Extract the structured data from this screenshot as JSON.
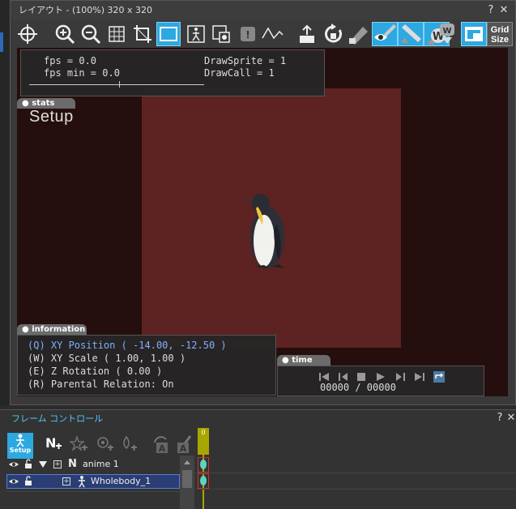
{
  "layout_window": {
    "title": "レイアウト - (100%)  320 x 320",
    "help_label": "?",
    "close_label": "✕"
  },
  "toolbar": {
    "icons": [
      "crosshair-icon",
      "zoom-in-icon",
      "zoom-out-icon",
      "grid-icon",
      "crop-icon",
      "frame-icon",
      "figure-icon",
      "layer-icon",
      "lock-icon",
      "curve-icon",
      "anchor-icon",
      "rotate-icon",
      "pin-icon",
      "eye-icon",
      "edit-icon",
      "w-icon",
      "w-down-icon",
      "window-icon"
    ],
    "grid_size_line1": "Grid",
    "grid_size_line2": "Size"
  },
  "fps_panel": {
    "fps": "fps = 0.0",
    "fps_min": "fps min = 0.0",
    "draw_sprite": "DrawSprite = 1",
    "draw_call": "DrawCall = 1"
  },
  "stats_tag": "● stats",
  "setup_label": "Setup",
  "information_tag": "● information",
  "information": {
    "xy_position": "(Q) XY Position ( -14.00, -12.50 )",
    "xy_scale": "(W) XY Scale ( 1.00, 1.00 )",
    "z_rotation": "(E) Z Rotation ( 0.00 )",
    "parental": "(R) Parental Relation: On"
  },
  "time_tag": "● time",
  "time": {
    "counter": "00000 / 00000"
  },
  "frame_window": {
    "title": "フレーム コントロール",
    "help_label": "?",
    "close_label": "✕",
    "setup_button": "Setup",
    "frame_number": "0"
  },
  "tree": {
    "rows": [
      {
        "label": "anime 1",
        "prefix": "N"
      },
      {
        "label": "Wholebody_1"
      }
    ]
  },
  "colors": {
    "accent": "#2ea8e0",
    "stage": "#5d2222",
    "canvas": "#250e0e",
    "frame_title": "#4fc8ff",
    "keyframe": "#5fd3c0",
    "timeline_marker": "#a7a700"
  }
}
